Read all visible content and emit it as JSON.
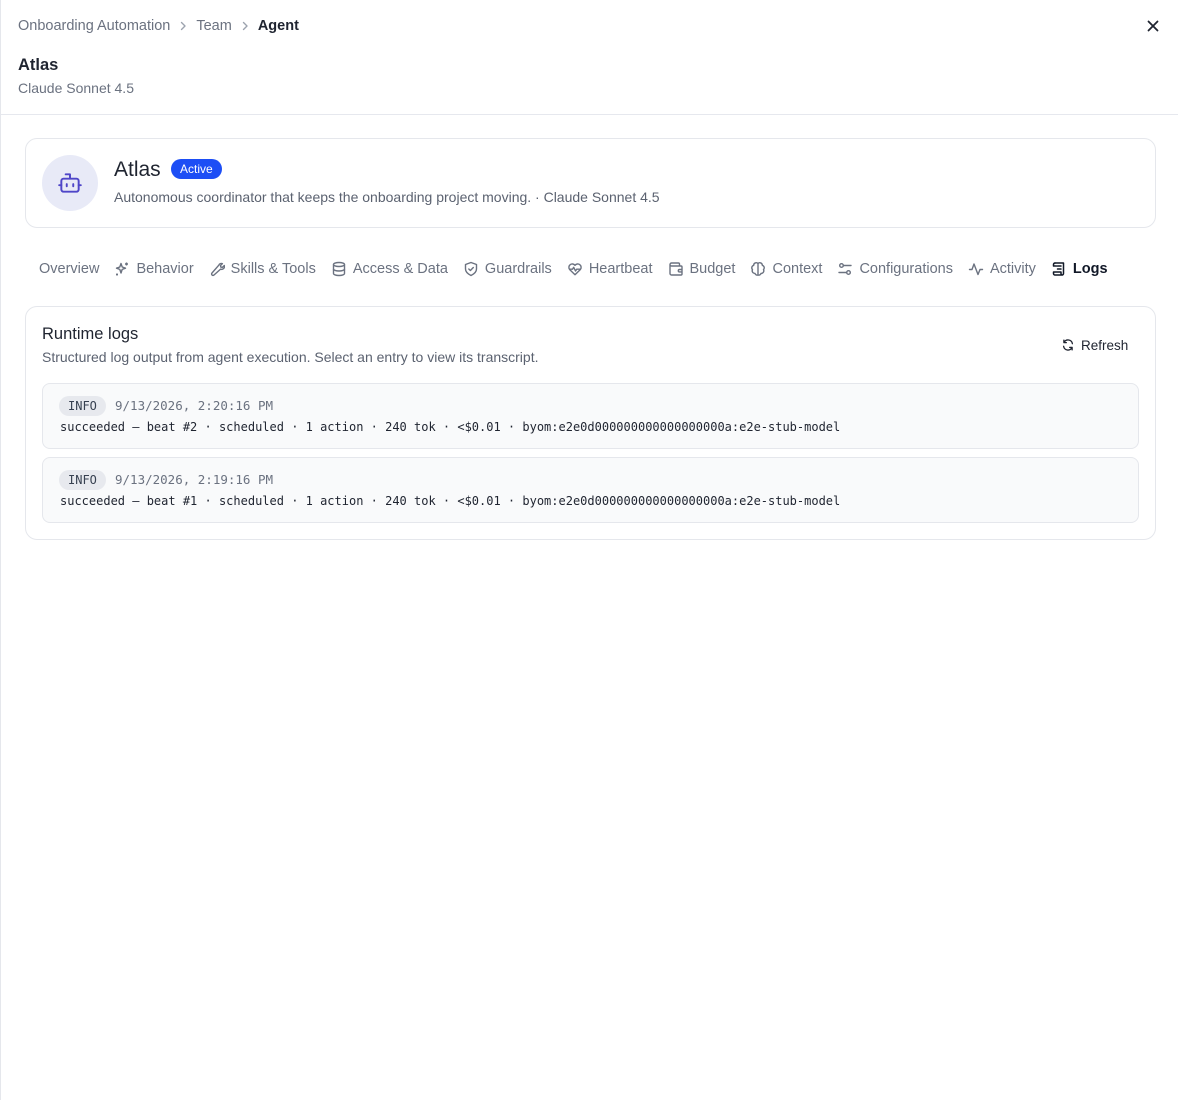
{
  "breadcrumb": [
    "Onboarding Automation",
    "Team",
    "Agent"
  ],
  "header": {
    "title": "Atlas",
    "subtitle": "Claude Sonnet 4.5"
  },
  "agent": {
    "name": "Atlas",
    "status": "Active",
    "description": "Autonomous coordinator that keeps the onboarding project moving. · Claude Sonnet 4.5"
  },
  "tabs": [
    {
      "label": "Overview",
      "icon": "none"
    },
    {
      "label": "Behavior",
      "icon": "sparkles-icon"
    },
    {
      "label": "Skills & Tools",
      "icon": "wrench-icon"
    },
    {
      "label": "Access & Data",
      "icon": "database-icon"
    },
    {
      "label": "Guardrails",
      "icon": "shield-icon"
    },
    {
      "label": "Heartbeat",
      "icon": "heart-pulse-icon"
    },
    {
      "label": "Budget",
      "icon": "wallet-icon"
    },
    {
      "label": "Context",
      "icon": "brain-icon"
    },
    {
      "label": "Configurations",
      "icon": "sliders-icon"
    },
    {
      "label": "Activity",
      "icon": "activity-icon"
    },
    {
      "label": "Logs",
      "icon": "logs-icon",
      "active": true
    }
  ],
  "logs": {
    "title": "Runtime logs",
    "subtitle": "Structured log output from agent execution. Select an entry to view its transcript.",
    "refresh_label": "Refresh",
    "entries": [
      {
        "level": "INFO",
        "timestamp": "9/13/2026, 2:20:16 PM",
        "message": "succeeded — beat #2 · scheduled · 1 action · 240 tok · <$0.01 · byom:e2e0d000000000000000000a:e2e-stub-model"
      },
      {
        "level": "INFO",
        "timestamp": "9/13/2026, 2:19:16 PM",
        "message": "succeeded — beat #1 · scheduled · 1 action · 240 tok · <$0.01 · byom:e2e0d000000000000000000a:e2e-stub-model"
      }
    ]
  },
  "colors": {
    "accent": "#1d4ef5",
    "avatar_bg": "#e8eaf7",
    "avatar_icon": "#4f46c8"
  }
}
